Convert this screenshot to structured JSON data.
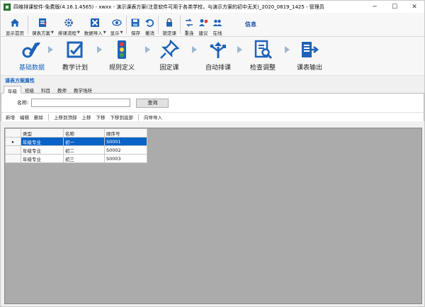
{
  "window": {
    "title": "四维排课软件-免费版(4.16.1.4565) - xwxx - 演示课表方案(注意软件可用于各类学校，与演示方案的初中无关)_2020_0819_1425 - 管理员",
    "controls": [
      "─",
      "☐",
      "✕"
    ]
  },
  "toolbar": {
    "items": [
      {
        "label": "显示首页",
        "icon": "home-icon",
        "caret": false
      },
      {
        "label": "课表方案",
        "icon": "schedule-plan-icon",
        "caret": true
      },
      {
        "label": "排课流程",
        "icon": "flow-gear-icon",
        "caret": true
      },
      {
        "label": "数据导入",
        "icon": "excel-import-icon",
        "caret": true
      },
      {
        "label": "显示",
        "icon": "eye-icon",
        "caret": true
      },
      {
        "label": "保存",
        "icon": "save-icon",
        "caret": false
      },
      {
        "label": "撤消",
        "icon": "undo-icon",
        "caret": false
      },
      {
        "label": "锁定课",
        "icon": "lock-icon",
        "caret": false
      },
      {
        "label": "重连",
        "icon": "reconnect-icon",
        "caret": false
      },
      {
        "label": "建议",
        "icon": "suggest-icon",
        "caret": false
      },
      {
        "label": "在线",
        "icon": "online-users-icon",
        "caret": false
      }
    ],
    "info_label": "信息"
  },
  "workflow": {
    "steps": [
      {
        "label": "基础数据",
        "icon": "basic-data-icon",
        "active": true
      },
      {
        "label": "教学计划",
        "icon": "teaching-plan-icon",
        "active": false
      },
      {
        "label": "规则定义",
        "icon": "traffic-light-icon",
        "active": false
      },
      {
        "label": "固定课",
        "icon": "pin-icon",
        "active": false
      },
      {
        "label": "自动排课",
        "icon": "auto-schedule-icon",
        "active": false
      },
      {
        "label": "检查调整",
        "icon": "check-adjust-icon",
        "active": false
      },
      {
        "label": "课表输出",
        "icon": "export-icon",
        "active": false
      }
    ]
  },
  "section": {
    "title": "课表方案属性"
  },
  "tabs": [
    {
      "label": "年级",
      "active": true
    },
    {
      "label": "班级",
      "active": false
    },
    {
      "label": "科目",
      "active": false
    },
    {
      "label": "教师",
      "active": false
    },
    {
      "label": "教学场所",
      "active": false
    }
  ],
  "search": {
    "label": "名称:",
    "value": "",
    "button": "查询"
  },
  "subtoolbar": {
    "buttons": [
      "新增",
      "编辑",
      "删除",
      "上移到顶部",
      "上移",
      "下移",
      "下移到底部",
      "向导导入"
    ]
  },
  "grid": {
    "columns": [
      "类型",
      "名称",
      "顺序号"
    ],
    "rows": [
      {
        "type": "年级专业",
        "name": "初一",
        "order": "S0001",
        "selected": true,
        "marker": "▸"
      },
      {
        "type": "年级专业",
        "name": "初二",
        "order": "S0002",
        "selected": false,
        "marker": ""
      },
      {
        "type": "年级专业",
        "name": "初三",
        "order": "S0003",
        "selected": false,
        "marker": ""
      }
    ]
  },
  "colors": {
    "accent": "#1565c0",
    "selection": "#0a63c8",
    "grid_background": "#ababab"
  }
}
